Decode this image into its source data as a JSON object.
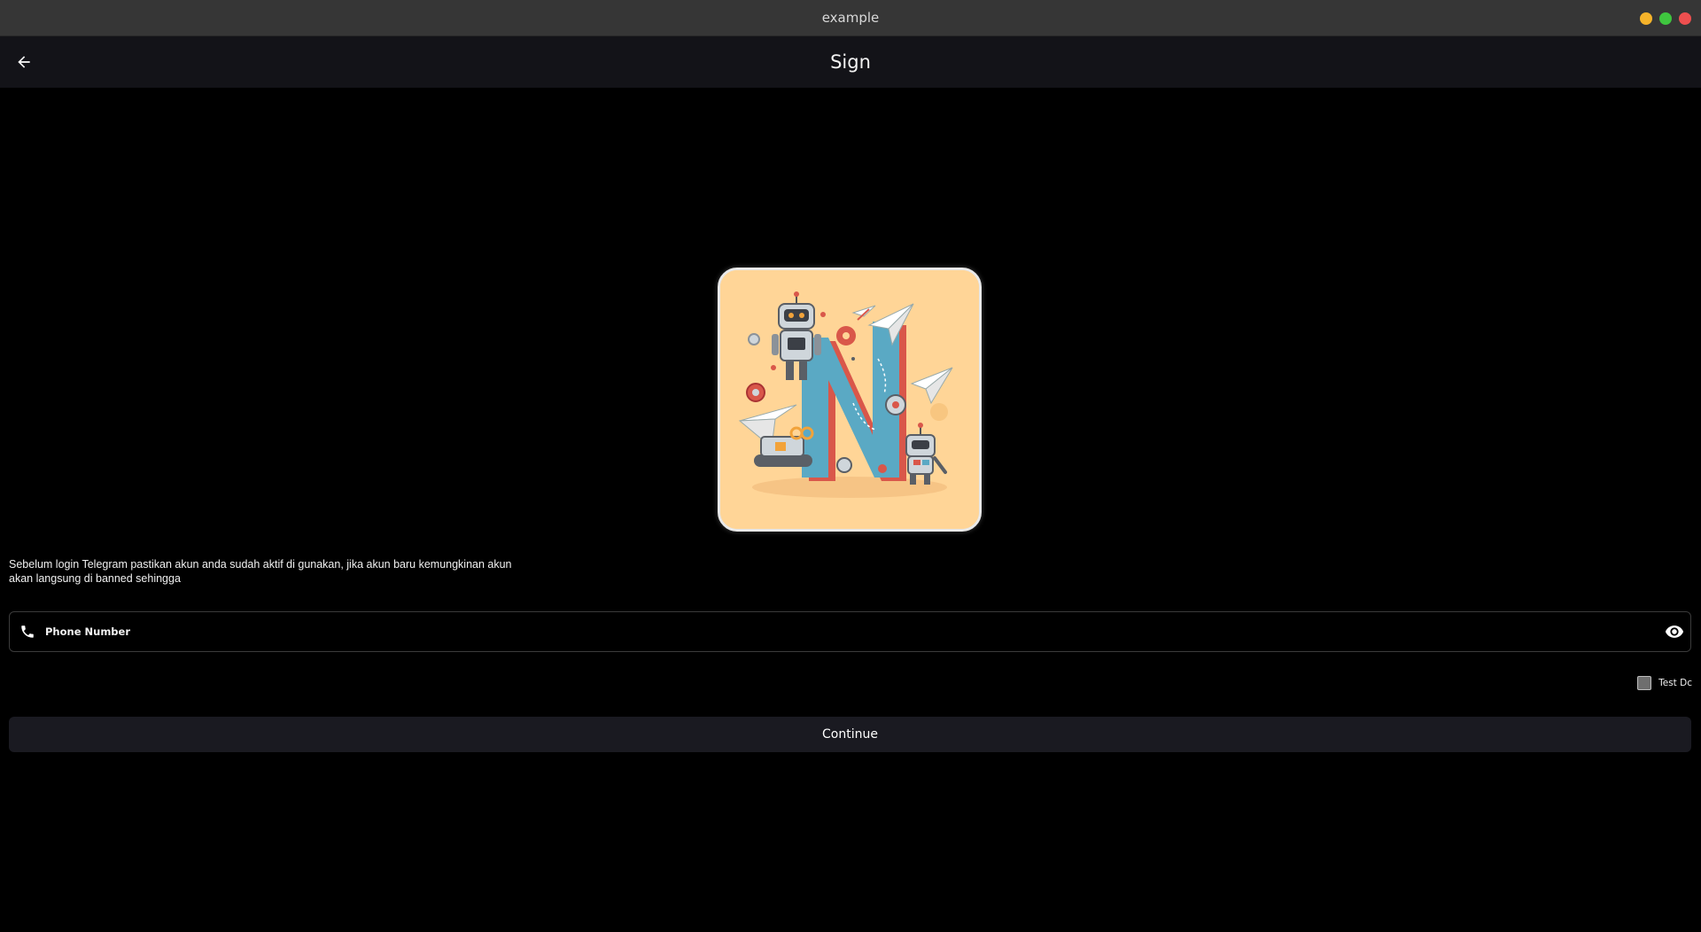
{
  "window": {
    "title": "example",
    "controls": [
      {
        "name": "minimize",
        "color": "#f6b32a"
      },
      {
        "name": "maximize",
        "color": "#3fc53f"
      },
      {
        "name": "close",
        "color": "#ee4f4f"
      }
    ]
  },
  "app_bar": {
    "title": "Sign",
    "back_icon": "arrow-left-icon"
  },
  "logo": {
    "icon": "n-robots-paper-planes-logo",
    "background_color": "#ffd597"
  },
  "notice": {
    "text": "Sebelum login Telegram pastikan akun anda sudah aktif di gunakan, jika akun baru kemungkinan akun akan langsung di banned sehingga"
  },
  "phone_field": {
    "value": "",
    "placeholder": "Phone Number",
    "leading_icon": "phone-icon",
    "trailing_icon": "eye-icon"
  },
  "test_dc": {
    "label": "Test Dc",
    "checked": false
  },
  "continue_button": {
    "label": "Continue"
  }
}
